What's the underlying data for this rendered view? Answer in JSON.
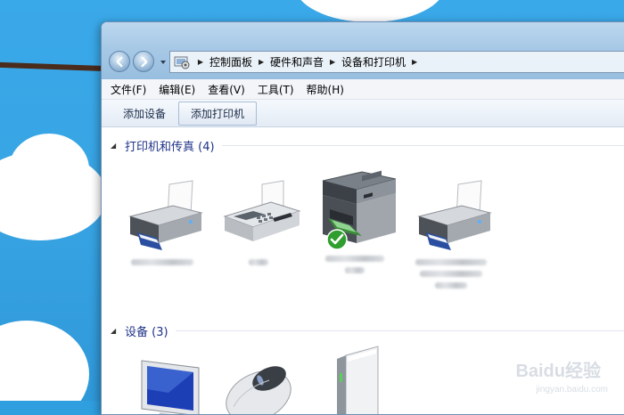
{
  "address_bar": {
    "crumbs": [
      "控制面板",
      "硬件和声音",
      "设备和打印机"
    ]
  },
  "menubar": {
    "items": [
      "文件(F)",
      "编辑(E)",
      "查看(V)",
      "工具(T)",
      "帮助(H)"
    ]
  },
  "toolbar": {
    "add_device": "添加设备",
    "add_printer": "添加打印机"
  },
  "groups": {
    "printers": {
      "title": "打印机和传真 (4)"
    },
    "devices": {
      "title": "设备 (3)"
    }
  },
  "icons": {
    "back": "back-arrow-icon",
    "forward": "forward-arrow-icon",
    "printer": "printer-icon",
    "fax": "fax-icon",
    "mfp": "multifunction-printer-icon",
    "default_check": "default-check-icon",
    "monitor": "monitor-icon",
    "mouse": "mouse-icon",
    "drive": "external-drive-icon"
  },
  "colors": {
    "group_header": "#1e3287",
    "desktop": "#3aa9e9",
    "default_check": "#2e9e2e"
  },
  "watermark": {
    "logo": "Baidu经验",
    "url": "jingyan.baidu.com"
  }
}
